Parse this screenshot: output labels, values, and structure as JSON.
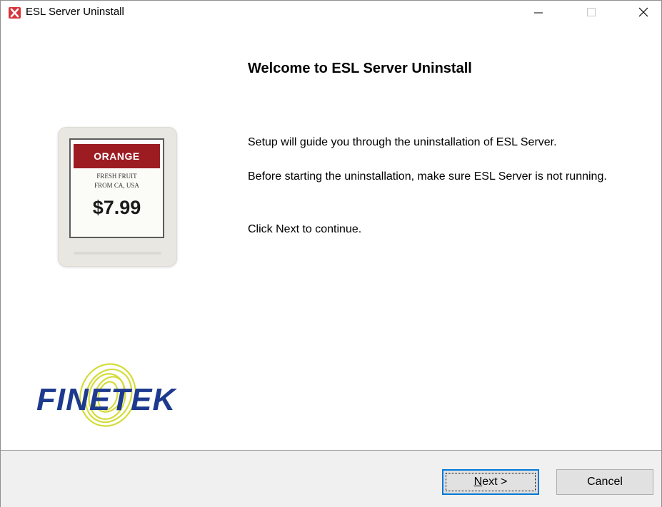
{
  "window": {
    "title": "ESL Server Uninstall",
    "icon": "app-red-x-icon"
  },
  "titlebar_buttons": {
    "minimize_icon": "minimize-icon",
    "maximize_icon": "maximize-icon",
    "close_icon": "close-icon"
  },
  "main": {
    "heading": "Welcome to ESL Server Uninstall",
    "paragraph1": "Setup will guide you through the uninstallation of ESL Server.",
    "paragraph2": "Before starting the uninstallation, make sure ESL Server is not running.",
    "paragraph3": "Click Next to continue."
  },
  "illustration": {
    "banner": "ORANGE",
    "line1": "FRESH FRUIT",
    "line2": "FROM CA, USA",
    "price": "$7.99"
  },
  "logo": {
    "text": "FINETEK",
    "color": "#1d3a8f",
    "accent_color": "#d4dc3a"
  },
  "footer": {
    "next_mnemonic": "N",
    "next_rest": "ext >",
    "cancel_label": "Cancel"
  },
  "colors": {
    "banner": "#9c1c22",
    "focus": "#0078d7"
  }
}
